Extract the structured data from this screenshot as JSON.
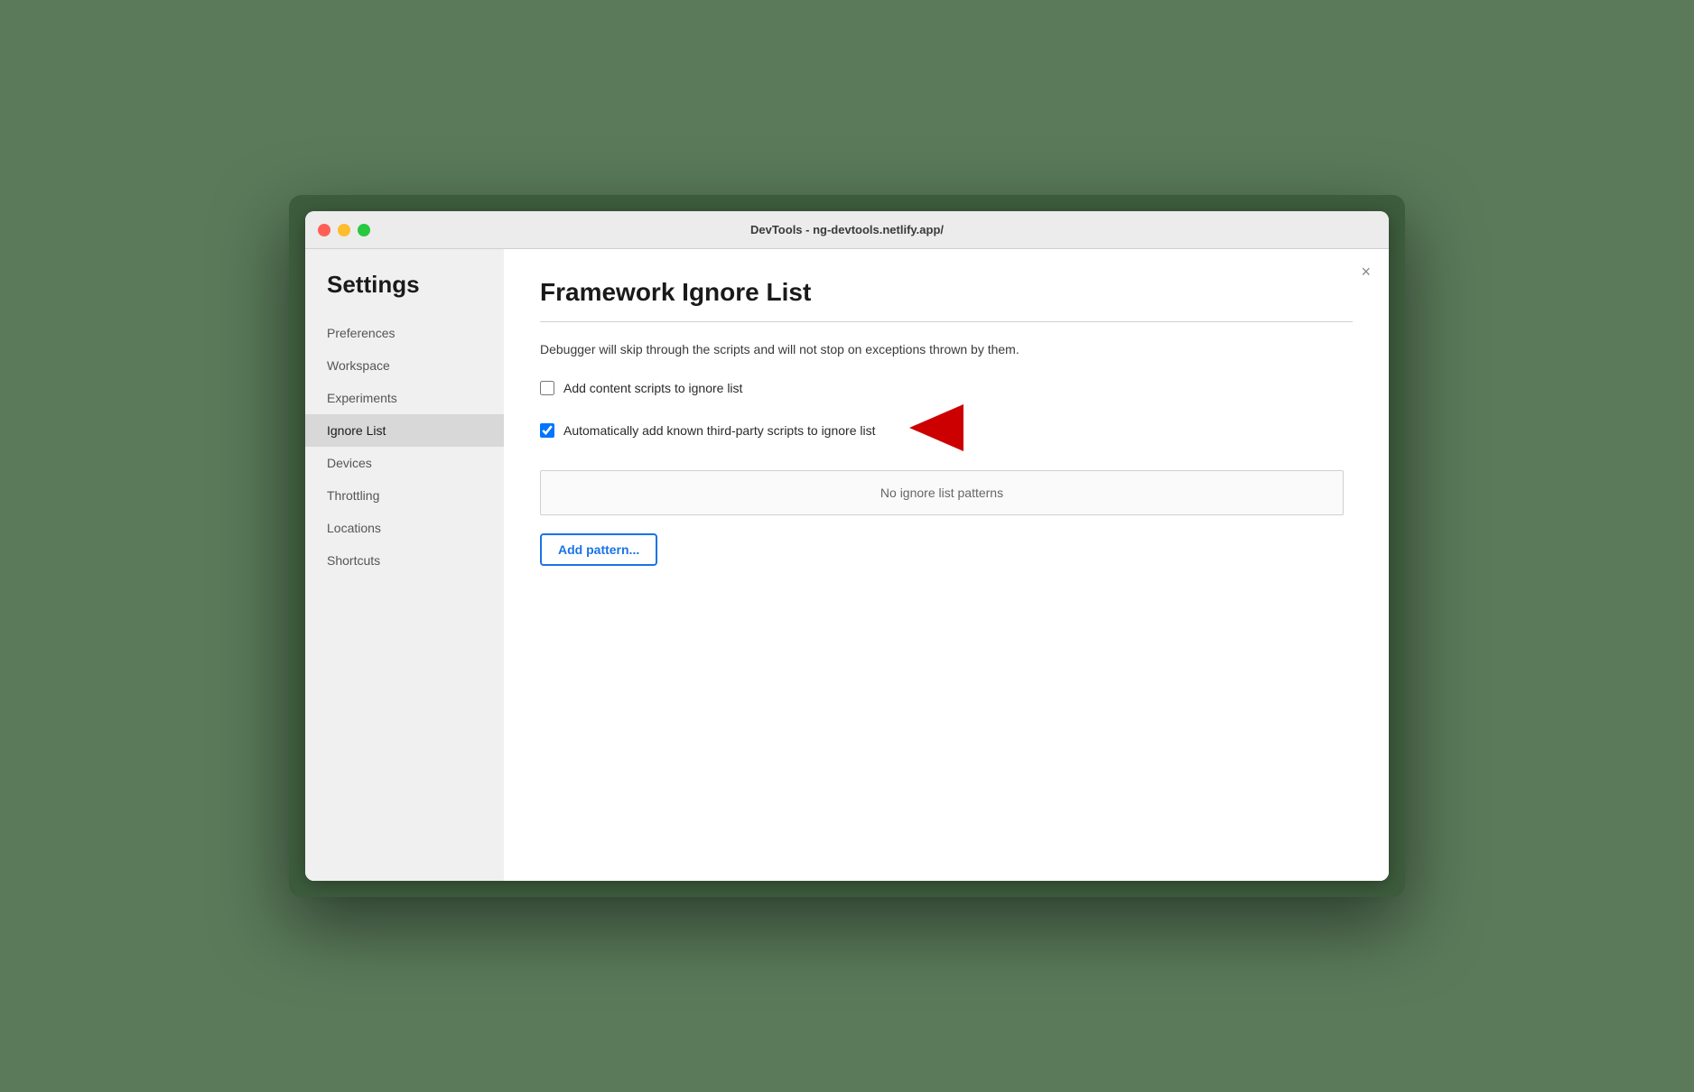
{
  "window": {
    "title": "DevTools - ng-devtools.netlify.app/"
  },
  "sidebar": {
    "heading": "Settings",
    "items": [
      {
        "id": "preferences",
        "label": "Preferences",
        "active": false
      },
      {
        "id": "workspace",
        "label": "Workspace",
        "active": false
      },
      {
        "id": "experiments",
        "label": "Experiments",
        "active": false
      },
      {
        "id": "ignore-list",
        "label": "Ignore List",
        "active": true
      },
      {
        "id": "devices",
        "label": "Devices",
        "active": false
      },
      {
        "id": "throttling",
        "label": "Throttling",
        "active": false
      },
      {
        "id": "locations",
        "label": "Locations",
        "active": false
      },
      {
        "id": "shortcuts",
        "label": "Shortcuts",
        "active": false
      }
    ]
  },
  "main": {
    "close_label": "×",
    "page_title": "Framework Ignore List",
    "description": "Debugger will skip through the scripts and will not stop on exceptions thrown by them.",
    "checkboxes": [
      {
        "id": "add-content-scripts",
        "label": "Add content scripts to ignore list",
        "checked": false
      },
      {
        "id": "auto-add-third-party",
        "label": "Automatically add known third-party scripts to ignore list",
        "checked": true
      }
    ],
    "patterns_empty_text": "No ignore list patterns",
    "add_pattern_label": "Add pattern..."
  }
}
